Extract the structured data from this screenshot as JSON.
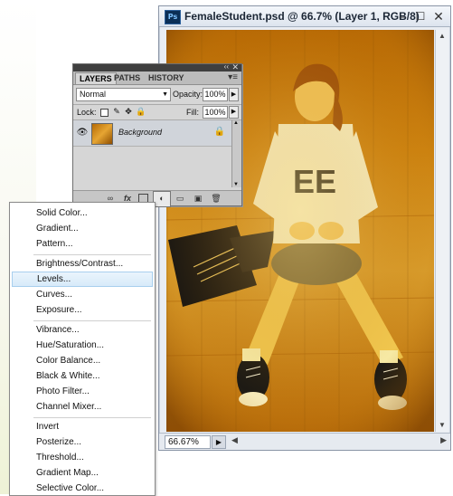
{
  "document": {
    "ps_badge": "Ps",
    "title": "FemaleStudent.psd @ 66.7% (Layer 1, RGB/8)",
    "zoom": "66.67%",
    "window_controls": {
      "minimize": "–",
      "maximize": "☐",
      "close": "✕"
    }
  },
  "layers_panel": {
    "collapse_glyph": "‹‹",
    "close_glyph": "✕",
    "tabs": [
      {
        "label": "LAYERS",
        "active": true
      },
      {
        "label": "PATHS",
        "active": false
      },
      {
        "label": "HISTORY",
        "active": false
      }
    ],
    "menu_glyph": "▾≡",
    "blend_mode": "Normal",
    "opacity_label": "Opacity:",
    "opacity_value": "100%",
    "lock_label": "Lock:",
    "fill_label": "Fill:",
    "fill_value": "100%",
    "layers": [
      {
        "name": "Background",
        "visible": true,
        "locked": true
      }
    ]
  },
  "adjustment_menu": {
    "groups": [
      [
        "Solid Color...",
        "Gradient...",
        "Pattern..."
      ],
      [
        "Brightness/Contrast...",
        "Levels...",
        "Curves...",
        "Exposure..."
      ],
      [
        "Vibrance...",
        "Hue/Saturation...",
        "Color Balance...",
        "Black & White...",
        "Photo Filter...",
        "Channel Mixer..."
      ],
      [
        "Invert",
        "Posterize...",
        "Threshold...",
        "Gradient Map...",
        "Selective Color..."
      ]
    ],
    "highlighted": "Levels..."
  },
  "colors": {
    "photo_base": "#c57b0c",
    "highlight": "#d7eaf9"
  }
}
